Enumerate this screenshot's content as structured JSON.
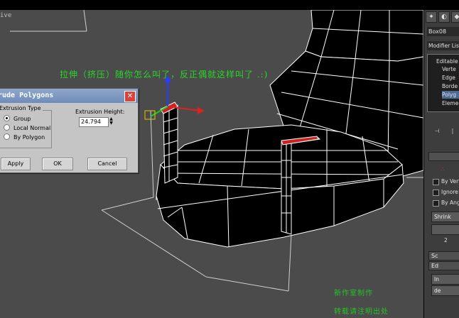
{
  "viewport": {
    "label": "ive",
    "annotation": "拉伸（挤压）随你怎么叫了，反正偶就这样叫了 .:)"
  },
  "dialog": {
    "title": "rude Polygons",
    "close": "✕",
    "extrusion_type_label": "Extrusion Type",
    "radio_options": [
      {
        "label": "Group",
        "selected": true
      },
      {
        "label": "Local Normal",
        "selected": false
      },
      {
        "label": "By Polygon",
        "selected": false
      }
    ],
    "height_label": "Extrusion Height:",
    "height_value": "24.794",
    "buttons": {
      "apply": "Apply",
      "ok": "OK",
      "cancel": "Cancel"
    }
  },
  "panel": {
    "object_name": "Box08",
    "modifier_list": "Modifier List",
    "stack": [
      {
        "label": "Editable",
        "selected": false
      },
      {
        "label": "Verte",
        "selected": false
      },
      {
        "label": "Edge",
        "selected": false
      },
      {
        "label": "Borde",
        "selected": false
      },
      {
        "label": "Polyg",
        "selected": true
      },
      {
        "label": "Eleme",
        "selected": false
      }
    ],
    "options": {
      "by_vertex": "By Vert",
      "ignore": "Ignore",
      "by_angle": "By Ang"
    },
    "shrink": "Shrink",
    "rollouts": {
      "r1": "Sc",
      "r2": "Ed"
    },
    "button_in": "In",
    "button_de": "de",
    "spinner_value": "2"
  },
  "watermarks": {
    "line1": "新作室制作",
    "line2": "转载请注明出处"
  },
  "colors": {
    "viewport_bg": "#4b4b4b",
    "wire": "#ffffff",
    "selected_face": "#cc2222",
    "annotation": "#29d629"
  }
}
